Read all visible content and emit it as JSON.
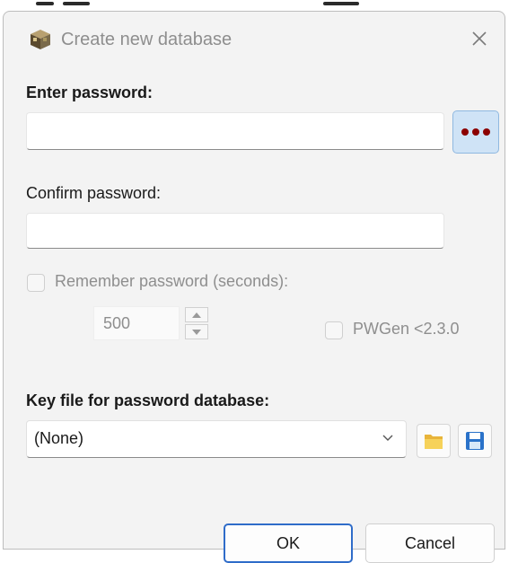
{
  "window": {
    "title": "Create new database",
    "app_icon": "cube-icon",
    "close_icon": "close-icon"
  },
  "password": {
    "label": "Enter password:",
    "value": "",
    "generate_button_icon": "three-dots-icon"
  },
  "confirm": {
    "label": "Confirm password:",
    "value": ""
  },
  "remember": {
    "label": "Remember password (seconds):",
    "checked": false,
    "seconds": "500"
  },
  "pwgen": {
    "label": "PWGen <2.3.0",
    "checked": false
  },
  "keyfile": {
    "label": "Key file for password database:",
    "selected": "(None)",
    "open_icon": "folder-icon",
    "save_icon": "save-icon"
  },
  "buttons": {
    "ok": "OK",
    "cancel": "Cancel"
  },
  "colors": {
    "accent": "#2f6cc9",
    "dots": "#8b0000",
    "generate_bg": "#cfe3f6",
    "dialog_bg": "#f3f3f3"
  }
}
